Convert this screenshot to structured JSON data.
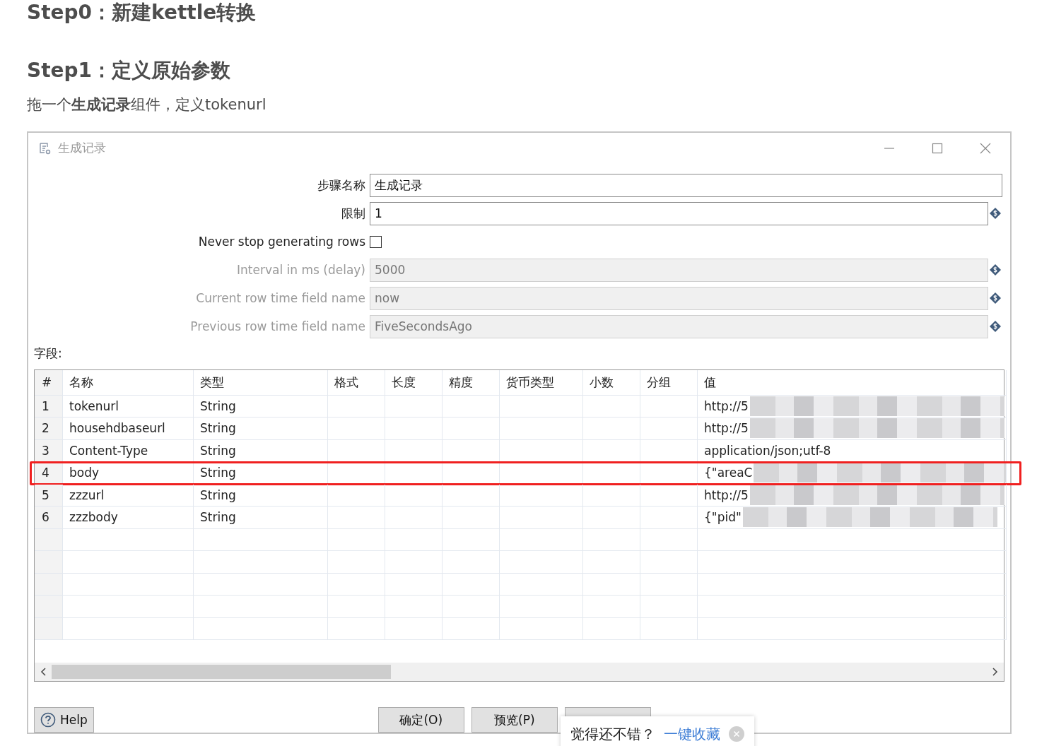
{
  "article": {
    "headings": [
      "Step0：新建kettle转换",
      "Step1：定义原始参数"
    ],
    "paragraph": "拖一个**生成记录**组件，定义tokenurl"
  },
  "dialog": {
    "title": "生成记录",
    "fields": [
      {
        "kind": "text",
        "label": "步骤名称",
        "value": "生成记录",
        "disabled": false,
        "variable": false
      },
      {
        "kind": "text",
        "label": "限制",
        "value": "1",
        "disabled": false,
        "variable": true
      },
      {
        "kind": "checkbox",
        "label": "Never stop generating rows",
        "checked": false
      },
      {
        "kind": "text",
        "label": "Interval in ms (delay)",
        "value": "5000",
        "disabled": true,
        "variable": true
      },
      {
        "kind": "text",
        "label": "Current row time field name",
        "value": "now",
        "disabled": true,
        "variable": true
      },
      {
        "kind": "text",
        "label": "Previous row time field name",
        "value": "FiveSecondsAgo",
        "disabled": true,
        "variable": true
      }
    ],
    "fields_label": "字段:",
    "table": {
      "columns": [
        "#",
        "名称",
        "类型",
        "格式",
        "长度",
        "精度",
        "货币类型",
        "小数",
        "分组",
        "值"
      ],
      "rows": [
        {
          "cells": [
            "1",
            "tokenurl",
            "String",
            "",
            "",
            "",
            "",
            "",
            "",
            "http://5"
          ],
          "redacted": true,
          "highlighted": false
        },
        {
          "cells": [
            "2",
            "househdbaseurl",
            "String",
            "",
            "",
            "",
            "",
            "",
            "",
            "http://5"
          ],
          "redacted": true,
          "highlighted": false
        },
        {
          "cells": [
            "3",
            "Content-Type",
            "String",
            "",
            "",
            "",
            "",
            "",
            "",
            "application/json;utf-8"
          ],
          "redacted": false,
          "highlighted": false
        },
        {
          "cells": [
            "4",
            "body",
            "String",
            "",
            "",
            "",
            "",
            "",
            "",
            "{\"areaC"
          ],
          "redacted": true,
          "highlighted": true
        },
        {
          "cells": [
            "5",
            "zzzurl",
            "String",
            "",
            "",
            "",
            "",
            "",
            "",
            "http://5"
          ],
          "redacted": true,
          "highlighted": false
        },
        {
          "cells": [
            "6",
            "zzzbody",
            "String",
            "",
            "",
            "",
            "",
            "",
            "",
            "{\"pid\""
          ],
          "redacted": true,
          "highlighted": false
        }
      ]
    },
    "help_button": "Help",
    "buttons": [
      "确定(O)",
      "预览(P)"
    ]
  },
  "toast": {
    "text": "觉得还不错？",
    "link": "一键收藏"
  }
}
